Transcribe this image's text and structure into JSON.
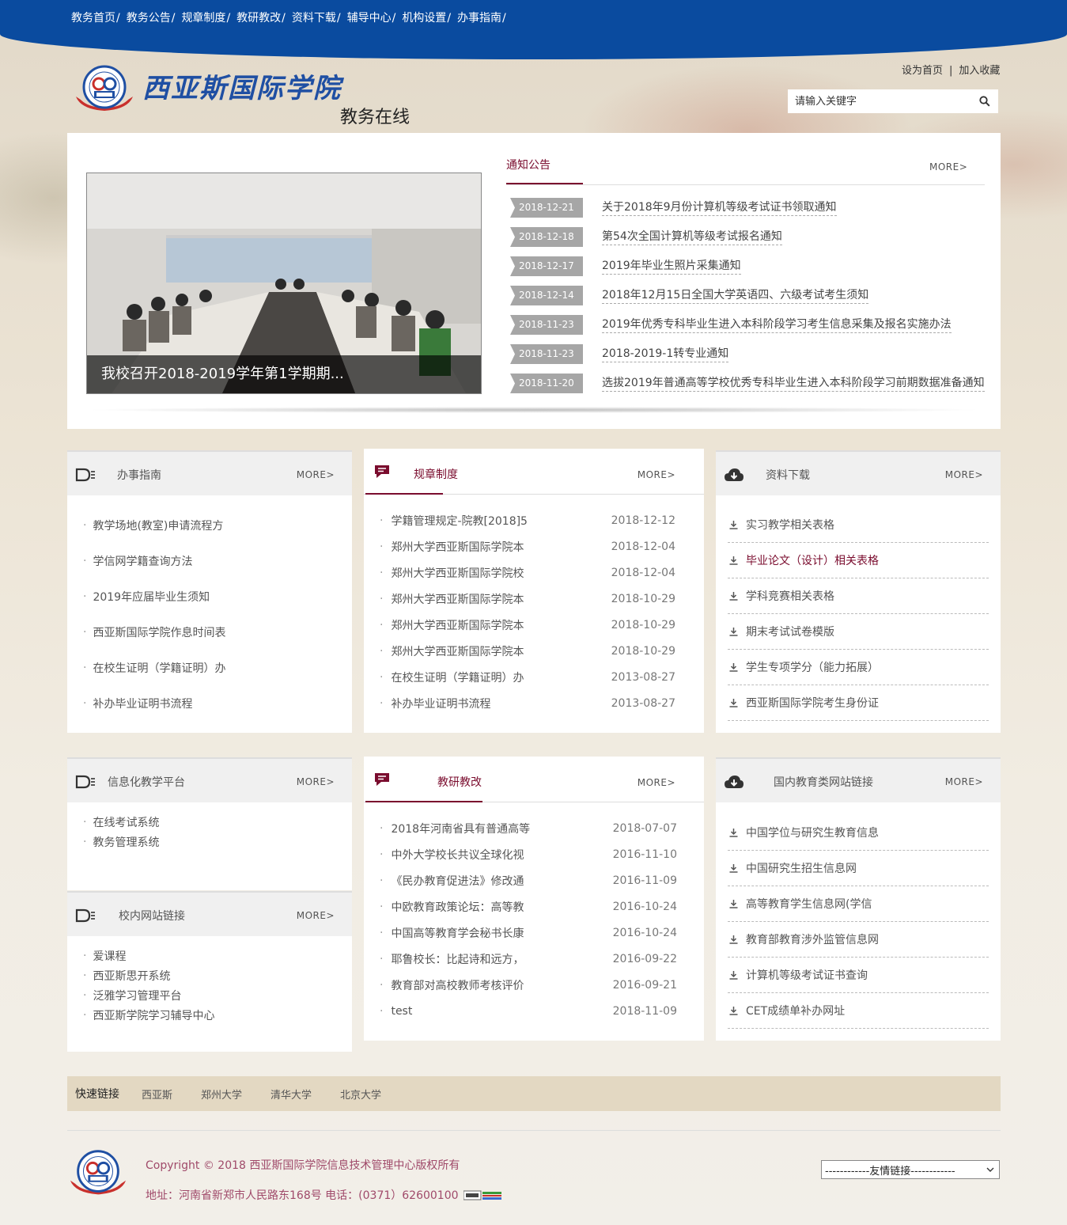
{
  "nav": [
    {
      "label": "教务首页",
      "sep": "/"
    },
    {
      "label": "教务公告",
      "sep": "/"
    },
    {
      "label": "规章制度",
      "sep": "/"
    },
    {
      "label": "教研教改",
      "sep": "/"
    },
    {
      "label": "资料下载",
      "sep": "/"
    },
    {
      "label": "辅导中心",
      "sep": "/"
    },
    {
      "label": "机构设置",
      "sep": "/"
    },
    {
      "label": "办事指南",
      "sep": "/"
    }
  ],
  "header": {
    "site_name": "西亚斯国际学院",
    "site_sub": "教务在线",
    "set_home": "设为首页",
    "sep": "|",
    "add_fav": "加入收藏",
    "search_placeholder": "请输入关键字"
  },
  "slide": {
    "caption": "我校召开2018-2019学年第1学期期..."
  },
  "notice": {
    "title": "通知公告",
    "more": "MORE>",
    "items": [
      {
        "date": "2018-12-21",
        "text": "关于2018年9月份计算机等级考试证书领取通知"
      },
      {
        "date": "2018-12-18",
        "text": "第54次全国计算机等级考试报名通知"
      },
      {
        "date": "2018-12-17",
        "text": "2019年毕业生照片采集通知"
      },
      {
        "date": "2018-12-14",
        "text": "2018年12月15日全国大学英语四、六级考试考生须知"
      },
      {
        "date": "2018-11-23",
        "text": "2019年优秀专科毕业生进入本科阶段学习考生信息采集及报名实施办法"
      },
      {
        "date": "2018-11-23",
        "text": "2018-2019-1转专业通知"
      },
      {
        "date": "2018-11-20",
        "text": "选拔2019年普通高等学校优秀专科毕业生进入本科阶段学习前期数据准备通知"
      }
    ]
  },
  "guide": {
    "title": "办事指南",
    "more": "MORE>",
    "items": [
      "教学场地(教室)申请流程方",
      "学信网学籍查询方法",
      "2019年应届毕业生须知",
      "西亚斯国际学院作息时间表",
      "在校生证明（学籍证明）办",
      "补办毕业证明书流程"
    ]
  },
  "rules": {
    "title": "规章制度",
    "more": "MORE>",
    "items": [
      {
        "text": "学籍管理规定-院教[2018]5",
        "date": "2018-12-12"
      },
      {
        "text": "郑州大学西亚斯国际学院本",
        "date": "2018-12-04"
      },
      {
        "text": "郑州大学西亚斯国际学院校",
        "date": "2018-12-04"
      },
      {
        "text": "郑州大学西亚斯国际学院本",
        "date": "2018-10-29"
      },
      {
        "text": "郑州大学西亚斯国际学院本",
        "date": "2018-10-29"
      },
      {
        "text": "郑州大学西亚斯国际学院本",
        "date": "2018-10-29"
      },
      {
        "text": "在校生证明（学籍证明）办",
        "date": "2013-08-27"
      },
      {
        "text": "补办毕业证明书流程",
        "date": "2013-08-27"
      }
    ]
  },
  "downloads": {
    "title": "资料下载",
    "more": "MORE>",
    "items": [
      "实习教学相关表格",
      "毕业论文（设计）相关表格",
      "学科竞赛相关表格",
      "期末考试试卷模版",
      "学生专项学分（能力拓展）",
      "西亚斯国际学院考生身份证"
    ]
  },
  "platform": {
    "title": "信息化教学平台",
    "more": "MORE>",
    "items": [
      "在线考试系统",
      "教务管理系统"
    ]
  },
  "campus": {
    "title": "校内网站链接",
    "more": "MORE>",
    "items": [
      "爱课程",
      "西亚斯思开系统",
      "泛雅学习管理平台",
      "西亚斯学院学习辅导中心"
    ]
  },
  "research": {
    "title": "教研教改",
    "more": "MORE>",
    "items": [
      {
        "text": "2018年河南省具有普通高等",
        "date": "2018-07-07"
      },
      {
        "text": "中外大学校长共议全球化视",
        "date": "2016-11-10"
      },
      {
        "text": "《民办教育促进法》修改通",
        "date": "2016-11-09"
      },
      {
        "text": "中欧教育政策论坛：高等教",
        "date": "2016-10-24"
      },
      {
        "text": "中国高等教育学会秘书长康",
        "date": "2016-10-24"
      },
      {
        "text": "耶鲁校长：比起诗和远方，",
        "date": "2016-09-22"
      },
      {
        "text": "教育部对高校教师考核评价",
        "date": "2016-09-21"
      },
      {
        "text": "test",
        "date": "2018-11-09"
      }
    ]
  },
  "edu_links": {
    "title": "国内教育类网站链接",
    "more": "MORE>",
    "items": [
      "中国学位与研究生教育信息",
      "中国研究生招生信息网",
      "高等教育学生信息网(学信",
      "教育部教育涉外监管信息网",
      "计算机等级考试证书查询",
      "CET成绩单补办网址"
    ]
  },
  "quick": {
    "label": "快速链接",
    "links": [
      "西亚斯",
      "郑州大学",
      "清华大学",
      "北京大学"
    ]
  },
  "footer": {
    "copyright": "Copyright © 2018 西亚斯国际学院信息技术管理中心版权所有",
    "address": "地址：河南省新郑市人民路东168号 电话：(0371）62600100",
    "friend_select": "------------友情链接------------"
  },
  "colors": {
    "nav_blue": "#0a4b9f",
    "accent_red": "#7a0c2e",
    "date_tag": "#a6a6a6"
  }
}
